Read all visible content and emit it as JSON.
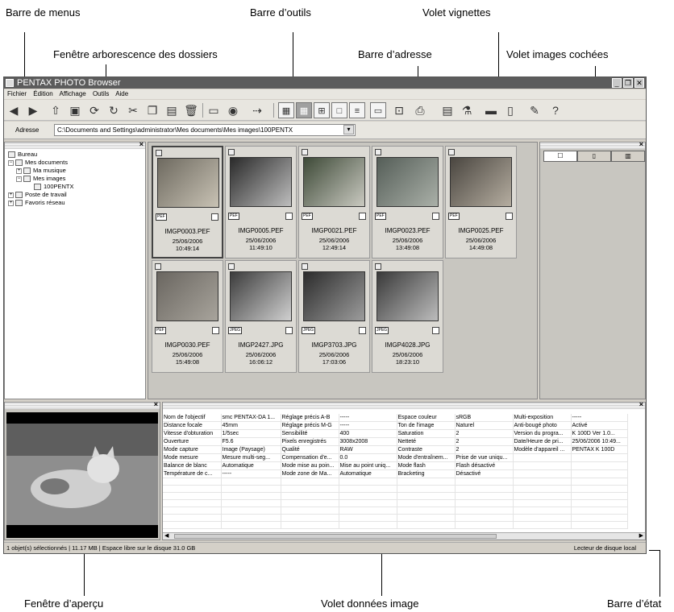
{
  "callouts": {
    "menu_bar": "Barre de menus",
    "tool_bar": "Barre d’outils",
    "thumbnail_pane": "Volet vignettes",
    "folder_tree": "Fenêtre arborescence des dossiers",
    "address_bar": "Barre d’adresse",
    "checked_pane": "Volet images cochées",
    "preview_window": "Fenêtre d’aperçu",
    "image_data_pane": "Volet données image",
    "status_bar": "Barre d’état"
  },
  "window": {
    "title": "PENTAX PHOTO Browser",
    "minimize_glyph": "_",
    "restore_glyph": "❐",
    "close_glyph": "✕"
  },
  "menu": [
    "Fichier",
    "Édition",
    "Affichage",
    "Outils",
    "Aide"
  ],
  "address": {
    "label": "Adresse",
    "value": "C:\\Documents and Settings\\administrator\\Mes documents\\Mes images\\100PENTX",
    "dropdown_glyph": "▾"
  },
  "tree": {
    "items": [
      "Bureau",
      "Mes documents",
      "Ma musique",
      "Mes images",
      "100PENTX",
      "Poste de travail",
      "Favoris réseau"
    ]
  },
  "thumbnails": [
    {
      "name": "IMGP0003.PEF",
      "date": "25/06/2006",
      "time": "10:49:14",
      "format": "PEF",
      "colors": [
        "#6e6a60",
        "#c8c2b4"
      ]
    },
    {
      "name": "IMGP0005.PEF",
      "date": "25/06/2006",
      "time": "11:49:10",
      "format": "PEF",
      "colors": [
        "#2a2a2a",
        "#bdbdbd"
      ]
    },
    {
      "name": "IMGP0021.PEF",
      "date": "25/06/2006",
      "time": "12:49:14",
      "format": "PEF",
      "colors": [
        "#3e4a38",
        "#c9c9c0"
      ]
    },
    {
      "name": "IMGP0023.PEF",
      "date": "25/06/2006",
      "time": "13:49:08",
      "format": "PEF",
      "colors": [
        "#555e58",
        "#aab0a8"
      ]
    },
    {
      "name": "IMGP0025.PEF",
      "date": "25/06/2006",
      "time": "14:49:08",
      "format": "PEF",
      "colors": [
        "#4a4640",
        "#b5ada0"
      ]
    },
    {
      "name": "IMGP0030.PEF",
      "date": "25/06/2006",
      "time": "15:49:08",
      "format": "PEF",
      "colors": [
        "#6a6660",
        "#a8a49c"
      ]
    },
    {
      "name": "IMGP2427.JPG",
      "date": "25/06/2006",
      "time": "16:06:12",
      "format": "JPEG",
      "colors": [
        "#3c3c3c",
        "#d0d0d0"
      ]
    },
    {
      "name": "IMGP3703.JPG",
      "date": "25/06/2006",
      "time": "17:03:06",
      "format": "JPEG",
      "colors": [
        "#2c2c2c",
        "#9c9c9c"
      ]
    },
    {
      "name": "IMGP4028.JPG",
      "date": "25/06/2006",
      "time": "18:23:10",
      "format": "JPEG",
      "colors": [
        "#3a3a3a",
        "#bcbcbc"
      ]
    }
  ],
  "image_data": {
    "rows": [
      [
        "Nom de l'objectif",
        "smc PENTAX-DA 1...",
        "Réglage précis A-B",
        "-----",
        "Espace couleur",
        "sRGB",
        "Multi-exposition",
        "-----"
      ],
      [
        "Distance focale",
        "45mm",
        "Réglage précis M-G",
        "-----",
        "Ton de l'image",
        "Naturel",
        "Anti-bougé photo",
        "Activé"
      ],
      [
        "Vitesse d'obturation",
        "1/5sec",
        "Sensibilité",
        "400",
        "Saturation",
        "2",
        "Version du progra...",
        "K 100D  Ver 1.0..."
      ],
      [
        "Ouverture",
        "F5.6",
        "Pixels enregistrés",
        "3008x2008",
        "Netteté",
        "2",
        "Date/Heure de pri...",
        "25/06/2006 10:49..."
      ],
      [
        "Mode capture",
        "Image (Paysage)",
        "Qualité",
        "RAW",
        "Contraste",
        "2",
        "Modèle d'appareil ...",
        "PENTAX K 100D"
      ],
      [
        "Mode mesure",
        "Mesure multi-seg...",
        "Compensation d'e...",
        "0.0",
        "Mode d'entraînem...",
        "Prise de vue uniqu...",
        "",
        ""
      ],
      [
        "Balance de blanc",
        "Automatique",
        "Mode mise au poin...",
        "Mise au point uniq...",
        "Mode flash",
        "Flash désactivé",
        "",
        ""
      ],
      [
        "Température de c...",
        "-----",
        "Mode zone de Ma...",
        "Automatique",
        "Bracketing",
        "Désactivé",
        "",
        ""
      ]
    ]
  },
  "status": {
    "left": "1 objet(s) sélectionnés | 11.17 MB | Espace libre sur le disque 31.0 GB",
    "right": "Lecteur de disque local"
  }
}
